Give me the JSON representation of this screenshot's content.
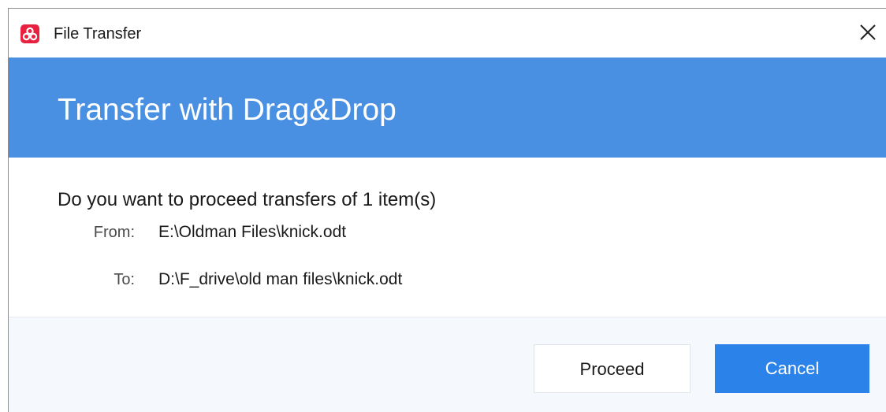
{
  "window": {
    "title": "File Transfer",
    "icon": "app-logo-icon",
    "close_icon": "close-icon"
  },
  "banner": {
    "title": "Transfer with Drag&Drop",
    "color": "#4a90e2"
  },
  "content": {
    "question": "Do you want to proceed transfers of 1 item(s)",
    "from_label": "From:",
    "from_value": "E:\\Oldman Files\\knick.odt",
    "to_label": "To:",
    "to_value": "D:\\F_drive\\old man files\\knick.odt"
  },
  "footer": {
    "proceed_label": "Proceed",
    "cancel_label": "Cancel",
    "accent": "#2b82e8"
  }
}
